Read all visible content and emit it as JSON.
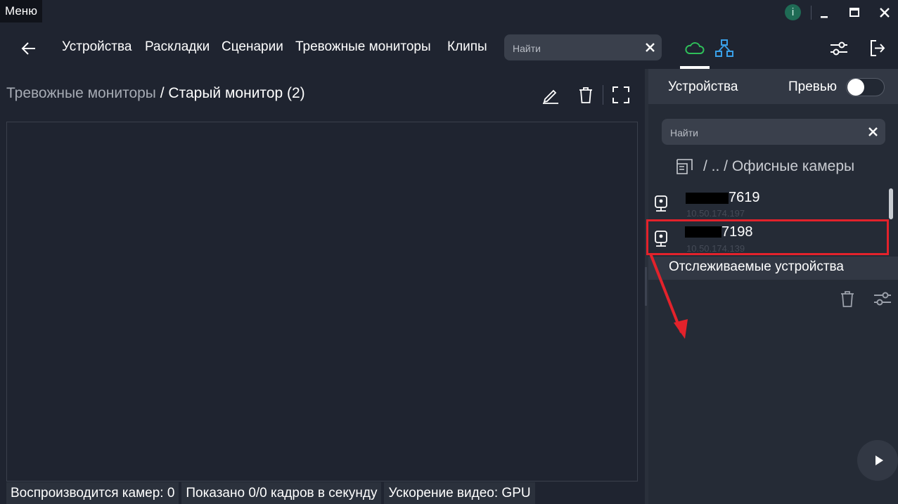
{
  "titlebar": {
    "menu_label": "Меню",
    "info_label": "i"
  },
  "nav": {
    "items": [
      "Устройства",
      "Раскладки",
      "Сценарии",
      "Тревожные мониторы",
      "Клипы"
    ],
    "search_placeholder": "Найти"
  },
  "breadcrumb": {
    "parent": "Тревожные мониторы",
    "separator": " / ",
    "current": "Старый монитор (2)"
  },
  "status": {
    "playing": "Воспроизводится камер: 0",
    "frames": "Показано 0/0 кадров в секунду",
    "accel": "Ускорение видео: GPU"
  },
  "right_panel": {
    "title": "Устройства",
    "preview_label": "Превью",
    "preview_enabled": false,
    "search_placeholder": "Найти",
    "folder_path": "/ .. / Офисные камеры",
    "devices": [
      {
        "name_suffix": "7619",
        "ip": "10.50.174.197"
      },
      {
        "name_suffix": "7198",
        "ip": "10.50.174.139"
      }
    ],
    "tracked_title": "Отслеживаемые устройства"
  },
  "annotation": {
    "highlight_color": "#e3222b"
  }
}
